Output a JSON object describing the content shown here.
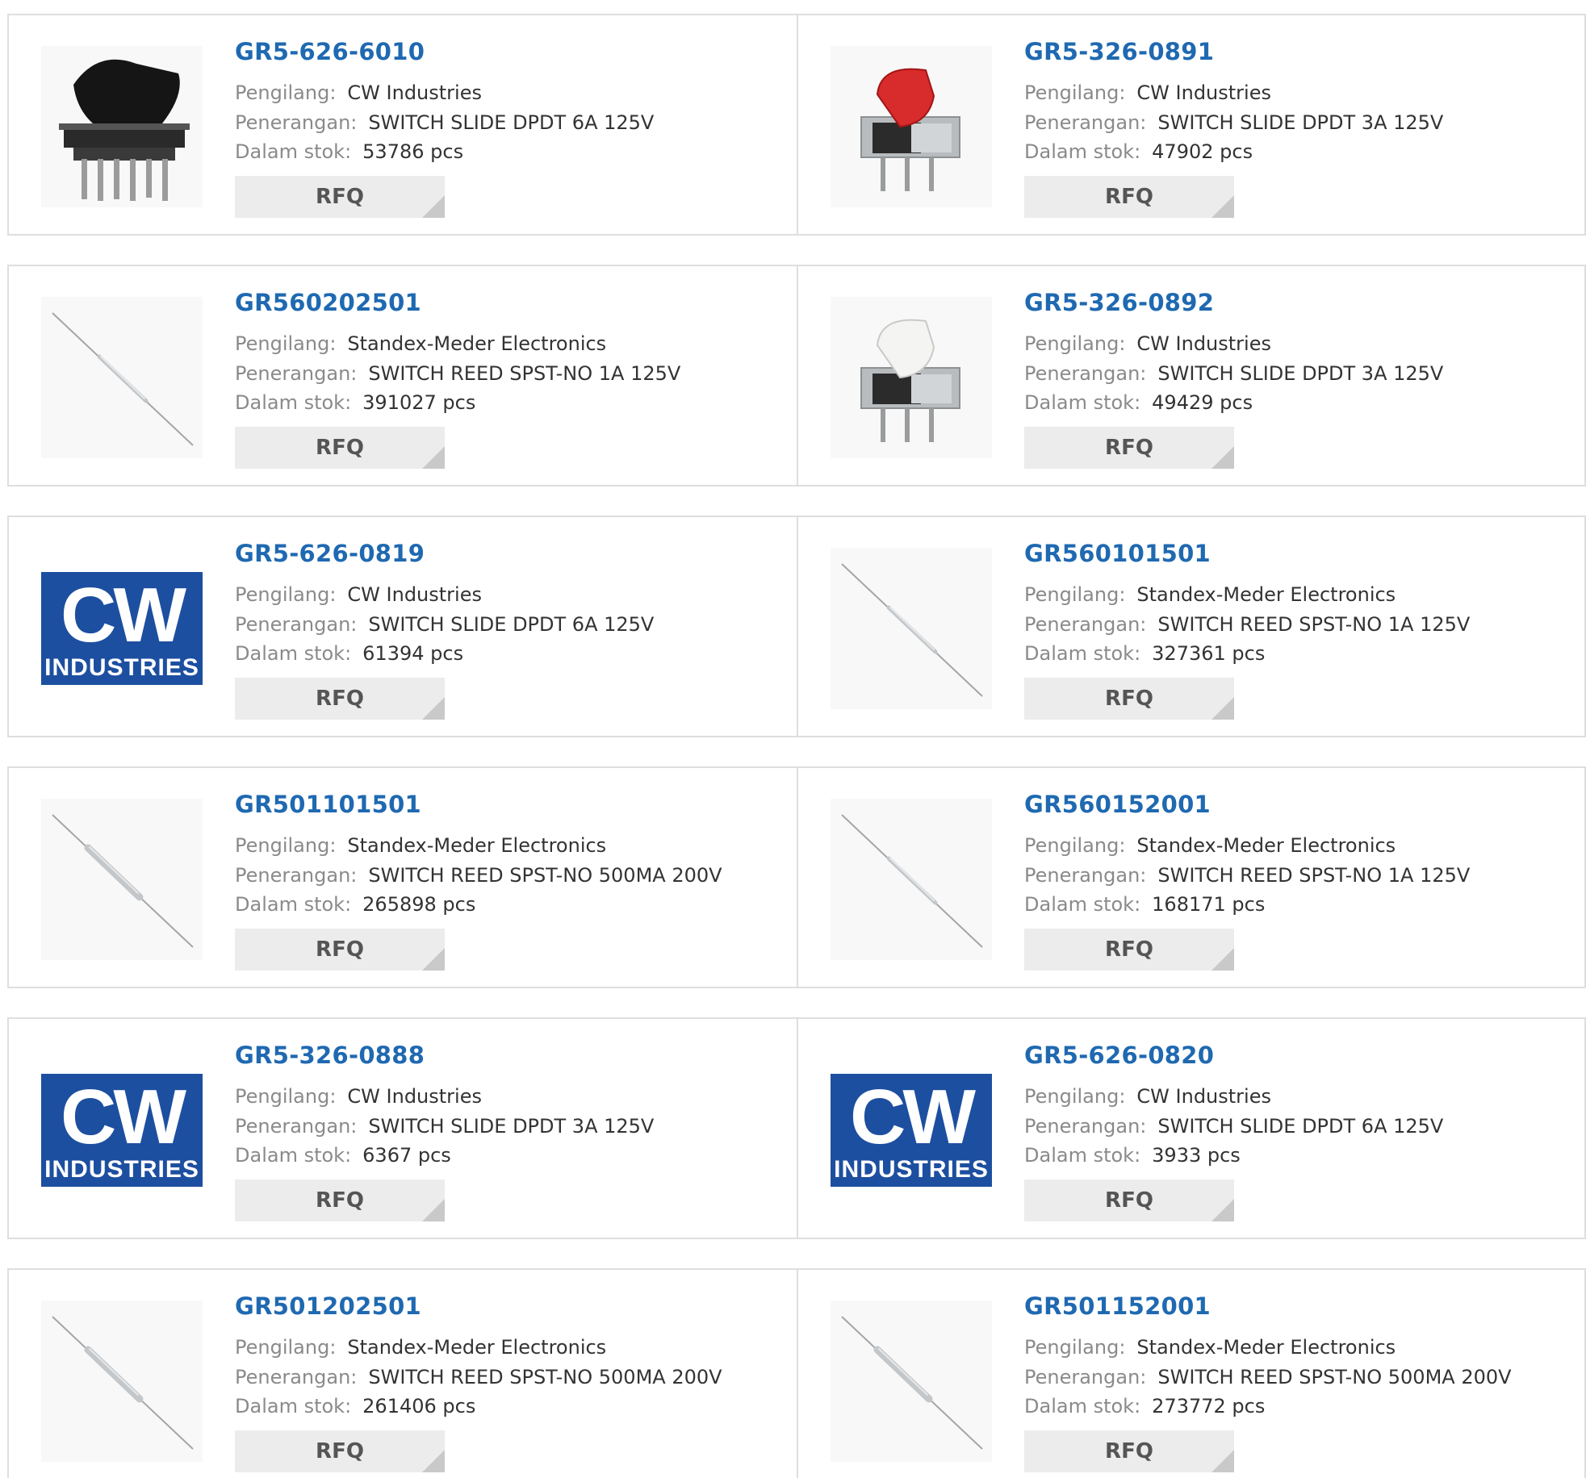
{
  "labels": {
    "manufacturer": "Pengilang:",
    "description": "Penerangan:",
    "stock": "Dalam stok:",
    "rfq": "RFQ"
  },
  "products": [
    {
      "part": "GR5-626-6010",
      "manufacturer": "CW Industries",
      "description": "SWITCH SLIDE DPDT 6A 125V",
      "stock": "53786 pcs",
      "image": "black-slide-switch"
    },
    {
      "part": "GR5-326-0891",
      "manufacturer": "CW Industries",
      "description": "SWITCH SLIDE DPDT 3A 125V",
      "stock": "47902 pcs",
      "image": "red-slide-switch"
    },
    {
      "part": "GR560202501",
      "manufacturer": "Standex-Meder Electronics",
      "description": "SWITCH REED SPST-NO 1A 125V",
      "stock": "391027 pcs",
      "image": "reed-switch"
    },
    {
      "part": "GR5-326-0892",
      "manufacturer": "CW Industries",
      "description": "SWITCH SLIDE DPDT 3A 125V",
      "stock": "49429 pcs",
      "image": "white-slide-switch"
    },
    {
      "part": "GR5-626-0819",
      "manufacturer": "CW Industries",
      "description": "SWITCH SLIDE DPDT 6A 125V",
      "stock": "61394 pcs",
      "image": "cw-industries-logo"
    },
    {
      "part": "GR560101501",
      "manufacturer": "Standex-Meder Electronics",
      "description": "SWITCH REED SPST-NO 1A 125V",
      "stock": "327361 pcs",
      "image": "reed-switch"
    },
    {
      "part": "GR501101501",
      "manufacturer": "Standex-Meder Electronics",
      "description": "SWITCH REED SPST-NO 500MA 200V",
      "stock": "265898 pcs",
      "image": "reed-switch-thick"
    },
    {
      "part": "GR560152001",
      "manufacturer": "Standex-Meder Electronics",
      "description": "SWITCH REED SPST-NO 1A 125V",
      "stock": "168171 pcs",
      "image": "reed-switch"
    },
    {
      "part": "GR5-326-0888",
      "manufacturer": "CW Industries",
      "description": "SWITCH SLIDE DPDT 3A 125V",
      "stock": "6367 pcs",
      "image": "cw-industries-logo"
    },
    {
      "part": "GR5-626-0820",
      "manufacturer": "CW Industries",
      "description": "SWITCH SLIDE DPDT 6A 125V",
      "stock": "3933 pcs",
      "image": "cw-industries-logo"
    },
    {
      "part": "GR501202501",
      "manufacturer": "Standex-Meder Electronics",
      "description": "SWITCH REED SPST-NO 500MA 200V",
      "stock": "261406 pcs",
      "image": "reed-switch-thick"
    },
    {
      "part": "GR501152001",
      "manufacturer": "Standex-Meder Electronics",
      "description": "SWITCH REED SPST-NO 500MA 200V",
      "stock": "273772 pcs",
      "image": "reed-switch-thick"
    }
  ],
  "logo": {
    "line1": "CW",
    "line2": "INDUSTRIES",
    "bg": "#1d4fa0",
    "fg": "#ffffff"
  },
  "colors": {
    "link": "#1f69b1",
    "label": "#8a8a8a",
    "value": "#333333",
    "border": "#dedede",
    "button": "#ececec"
  }
}
